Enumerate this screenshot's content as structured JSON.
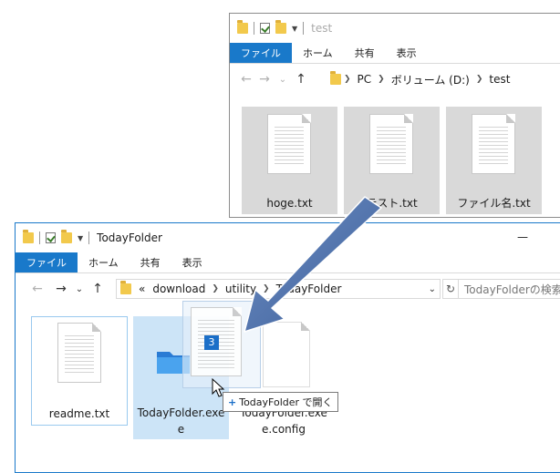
{
  "back_window": {
    "title": "test",
    "ribbon_tabs": [
      "ファイル",
      "ホーム",
      "共有",
      "表示"
    ],
    "breadcrumb": [
      "PC",
      "ボリューム (D:)",
      "test"
    ],
    "files": [
      "hoge.txt",
      "テスト.txt",
      "ファイル名.txt"
    ]
  },
  "front_window": {
    "title": "TodayFolder",
    "ribbon_tabs": [
      "ファイル",
      "ホーム",
      "共有",
      "表示"
    ],
    "breadcrumb_prefix": "«",
    "breadcrumb": [
      "download",
      "utility",
      "TodayFolder"
    ],
    "search_placeholder": "TodayFolderの検索",
    "minimize": "—",
    "files": [
      "readme.txt",
      "TodayFolder.exe",
      "TodayFolder.exe.config"
    ],
    "file_label_lines": {
      "exe_line1": "TodayFolder.exe",
      "exe_line2": "e",
      "config_line1": "TodayFolder.exe",
      "config_line2": "e.config"
    }
  },
  "drag": {
    "count_badge": "3",
    "tooltip_plus": "+",
    "tooltip_text": "TodayFolder で開く"
  },
  "icons": {
    "nav_back": "←",
    "nav_forward": "→",
    "nav_dropdown": "⌄",
    "nav_up": "↑",
    "refresh": "↻"
  },
  "colors": {
    "accent": "#1979ca",
    "selection": "#cce4f7",
    "arrow": "#4a6fa8"
  }
}
